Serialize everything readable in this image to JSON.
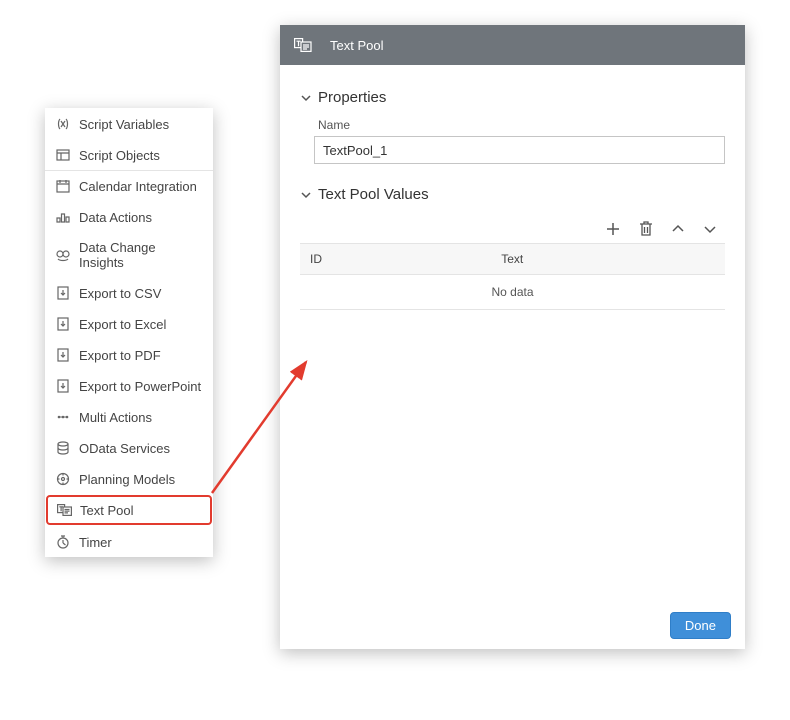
{
  "panel": {
    "title": "Text Pool",
    "properties_section": "Properties",
    "name_label": "Name",
    "name_value": "TextPool_1",
    "values_section": "Text Pool Values",
    "col_id": "ID",
    "col_text": "Text",
    "empty": "No data",
    "done": "Done"
  },
  "menu": {
    "items": [
      {
        "label": "Script Variables",
        "icon": "variables"
      },
      {
        "label": "Script Objects",
        "icon": "objects"
      },
      {
        "label": "Calendar Integration",
        "icon": "calendar",
        "sep": true
      },
      {
        "label": "Data Actions",
        "icon": "data-actions"
      },
      {
        "label": "Data Change Insights",
        "icon": "insights"
      },
      {
        "label": "Export to CSV",
        "icon": "export"
      },
      {
        "label": "Export to Excel",
        "icon": "export"
      },
      {
        "label": "Export to PDF",
        "icon": "export"
      },
      {
        "label": "Export to PowerPoint",
        "icon": "export"
      },
      {
        "label": "Multi Actions",
        "icon": "multi"
      },
      {
        "label": "OData Services",
        "icon": "odata"
      },
      {
        "label": "Planning Models",
        "icon": "planning"
      },
      {
        "label": "Text Pool",
        "icon": "textpool",
        "selected": true
      },
      {
        "label": "Timer",
        "icon": "timer"
      }
    ]
  }
}
